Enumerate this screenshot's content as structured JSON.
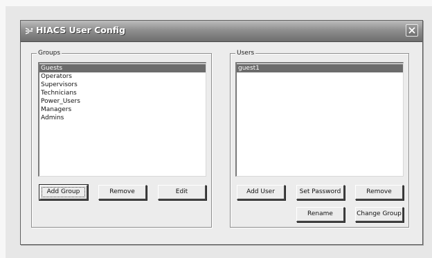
{
  "window": {
    "title": "HIACS User Config",
    "icon": "app-sparkle-icon",
    "close_icon": "close-x-icon"
  },
  "groups": {
    "legend": "Groups",
    "items": [
      {
        "label": "Guests",
        "selected": true
      },
      {
        "label": "Operators",
        "selected": false
      },
      {
        "label": "Supervisors",
        "selected": false
      },
      {
        "label": "Technicians",
        "selected": false
      },
      {
        "label": "Power_Users",
        "selected": false
      },
      {
        "label": "Managers",
        "selected": false
      },
      {
        "label": "Admins",
        "selected": false
      }
    ],
    "buttons": {
      "add": "Add Group",
      "remove": "Remove",
      "edit": "Edit"
    }
  },
  "users": {
    "legend": "Users",
    "items": [
      {
        "label": "guest1",
        "selected": true
      }
    ],
    "buttons": {
      "add": "Add User",
      "set_password": "Set Password",
      "remove": "Remove",
      "rename": "Rename",
      "change_group": "Change Group"
    }
  },
  "colors": {
    "selection": "#6b6b6b",
    "titlebar": "#8f8f8f",
    "dialog": "#ececec"
  }
}
